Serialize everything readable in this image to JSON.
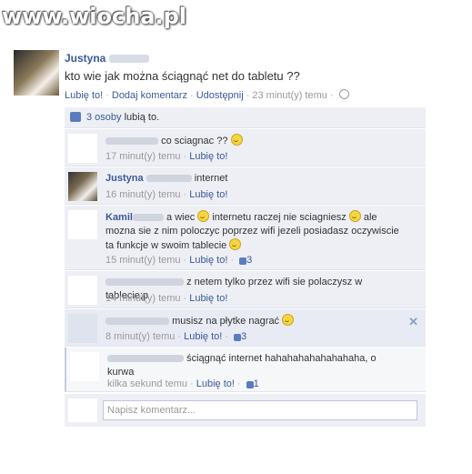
{
  "watermark": "www.wiocha.pl",
  "post": {
    "author": "Justyna",
    "text": "kto wie jak można ściągnąć net do tabletu ??",
    "actions": {
      "like": "Lubię to!",
      "comment": "Dodaj komentarz",
      "share": "Udostępnij",
      "time": "23 minut(y) temu"
    }
  },
  "likes": {
    "text": "3 osoby",
    "suffix": "lubią to."
  },
  "comments": [
    {
      "author": "",
      "text": "co sciagnac ??",
      "time": "17 minut(y) temu",
      "like": "Lubię to!"
    },
    {
      "author": "Justyna",
      "text": "internet",
      "time": "16 minut(y) temu",
      "like": "Lubię to!"
    },
    {
      "author": "Kamil",
      "text1": "a wiec",
      "text2": "internetu raczej nie sciagniesz",
      "text3": "ale mozna sie z nim poloczyc poprzez wifi jezeli posiadasz oczywiscie ta funkcje w swoim tablecie",
      "time": "15 minut(y) temu",
      "like": "Lubię to!",
      "count": "3"
    },
    {
      "author": "",
      "text": "z netem tylko przez wifi sie polaczysz w tablecie;p",
      "time": "14 minut(y) temu",
      "like": "Lubię to!"
    },
    {
      "author": "",
      "text": "musisz na płytke nagrać",
      "time": "8 minut(y) temu",
      "like": "Lubię to!",
      "count": "3"
    },
    {
      "author": "",
      "text": "ściągnąć internet hahahahahahahahaha, o kurwa",
      "time": "kilka sekund temu",
      "like": "Lubię to!",
      "count": "1"
    }
  ],
  "comment_box": {
    "placeholder": "Napisz komentarz..."
  },
  "colors": {
    "link": "#3b5998",
    "panel": "#edeff4",
    "meta": "#999999"
  }
}
